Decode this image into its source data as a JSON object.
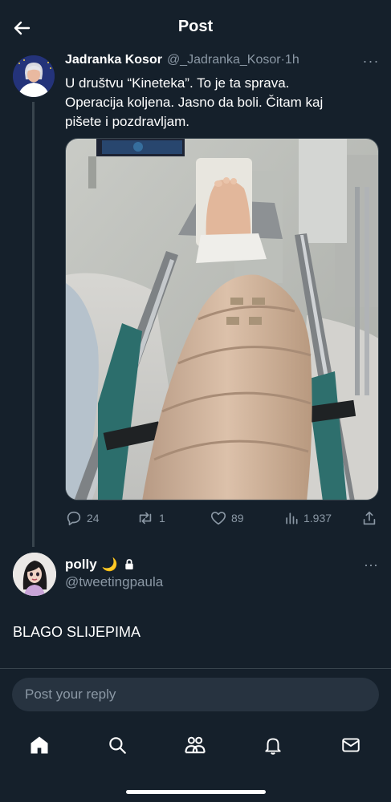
{
  "header": {
    "title": "Post",
    "back_icon": "arrow-left-icon"
  },
  "tweet": {
    "author_name": "Jadranka Kosor",
    "author_handle": "@_Jadranka_Kosor",
    "time": "1h",
    "separator": "·",
    "more": "···",
    "text_lines": [
      "U društvu “Kineteka”. To je ta sprava.",
      "Operacija koljena. Jasno da boli. Čitam kaj",
      "pišete i pozdravljam."
    ],
    "stats": {
      "replies": "24",
      "reposts": "1",
      "likes": "89",
      "views": "1.937"
    }
  },
  "reply": {
    "author_name": "polly",
    "emoji": "🌙",
    "author_handle": "@tweetingpaula",
    "more": "···",
    "text": "BLAGO SLIJEPIMA"
  },
  "composer": {
    "placeholder": "Post your reply"
  },
  "nav": {
    "items": [
      "home-icon",
      "search-icon",
      "communities-icon",
      "notifications-icon",
      "messages-icon"
    ]
  },
  "colors": {
    "background": "#15202b",
    "secondary_text": "#8b98a5",
    "border": "#38444d",
    "input_bg": "#273340"
  }
}
